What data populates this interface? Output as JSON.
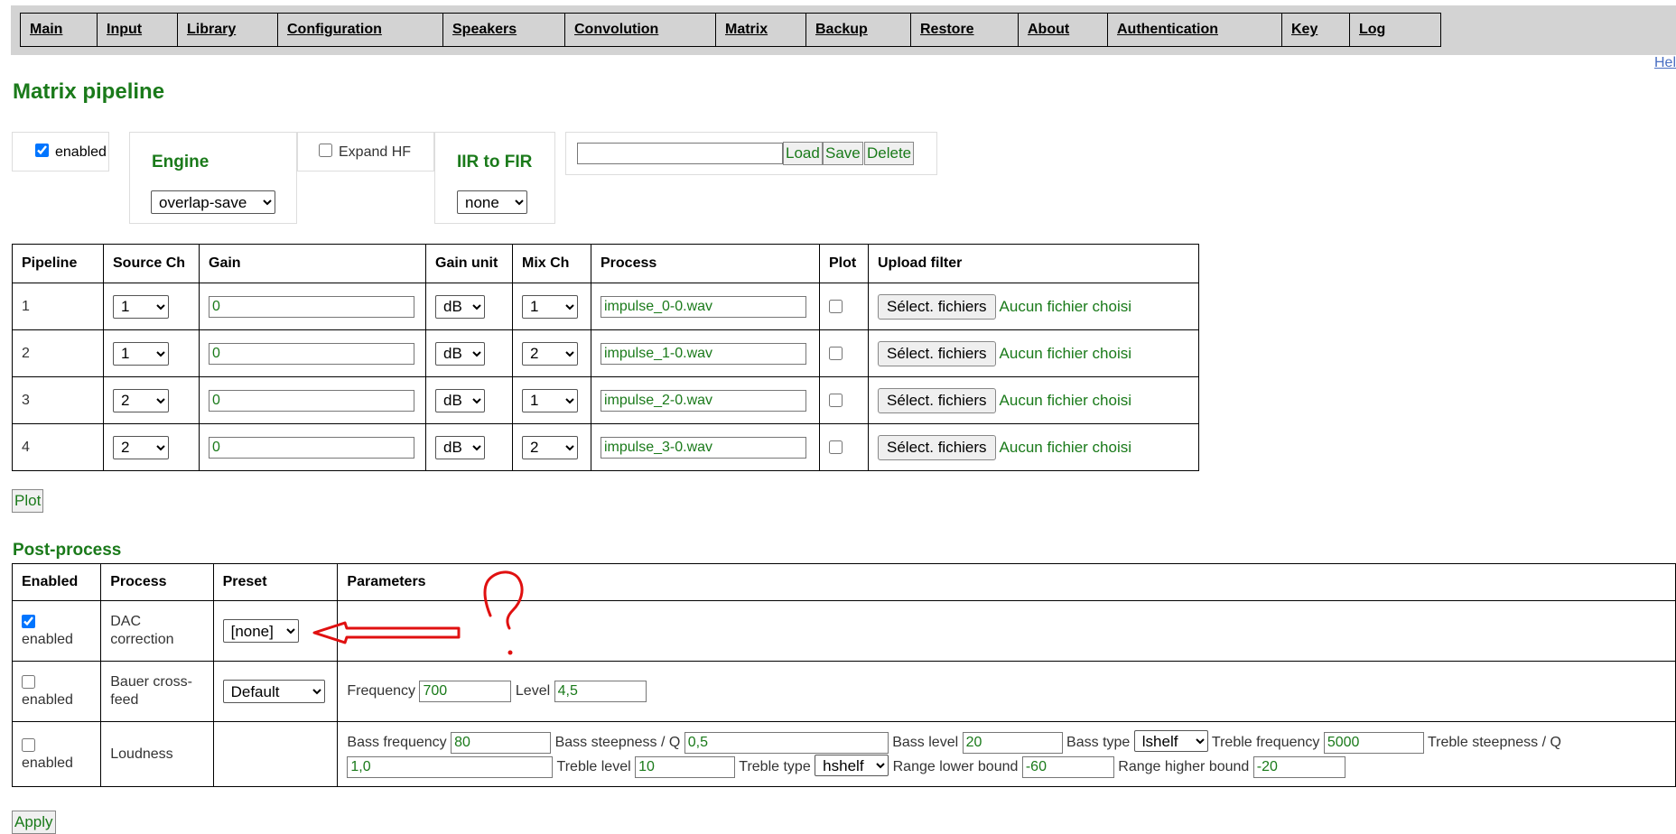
{
  "nav": {
    "items": [
      "Main",
      "Input",
      "Library",
      "Configuration",
      "Speakers",
      "Convolution",
      "Matrix",
      "Backup",
      "Restore",
      "About",
      "Authentication",
      "Key",
      "Log"
    ]
  },
  "help_link": "Hel",
  "page_title": "Matrix pipeline",
  "controls": {
    "enabled_label": "enabled",
    "engine_label": "Engine",
    "engine_value": "overlap-save",
    "expand_hf_label": "Expand HF",
    "iir_to_fir_label": "IIR to FIR",
    "iir_to_fir_value": "none",
    "preset_name_value": "",
    "load_label": "Load",
    "save_label": "Save",
    "delete_label": "Delete"
  },
  "pipeline_table": {
    "headers": [
      "Pipeline",
      "Source Ch",
      "Gain",
      "Gain unit",
      "Mix Ch",
      "Process",
      "Plot",
      "Upload filter"
    ],
    "rows": [
      {
        "pipeline": "1",
        "source_ch": "1",
        "gain": "0",
        "gain_unit": "dB",
        "mix_ch": "1",
        "process": "impulse_0-0.wav",
        "plot": false,
        "file_button": "Sélect. fichiers",
        "file_status": "Aucun fichier choisi"
      },
      {
        "pipeline": "2",
        "source_ch": "1",
        "gain": "0",
        "gain_unit": "dB",
        "mix_ch": "2",
        "process": "impulse_1-0.wav",
        "plot": false,
        "file_button": "Sélect. fichiers",
        "file_status": "Aucun fichier choisi"
      },
      {
        "pipeline": "3",
        "source_ch": "2",
        "gain": "0",
        "gain_unit": "dB",
        "mix_ch": "1",
        "process": "impulse_2-0.wav",
        "plot": false,
        "file_button": "Sélect. fichiers",
        "file_status": "Aucun fichier choisi"
      },
      {
        "pipeline": "4",
        "source_ch": "2",
        "gain": "0",
        "gain_unit": "dB",
        "mix_ch": "2",
        "process": "impulse_3-0.wav",
        "plot": false,
        "file_button": "Sélect. fichiers",
        "file_status": "Aucun fichier choisi"
      }
    ]
  },
  "plot_button": "Plot",
  "post_title": "Post-process",
  "post_table": {
    "headers": [
      "Enabled",
      "Process",
      "Preset",
      "Parameters"
    ],
    "dac": {
      "enabled": true,
      "enabled_label": "enabled",
      "process_line1": "DAC",
      "process_line2": "correction",
      "preset": "[none]"
    },
    "bauer": {
      "enabled": false,
      "enabled_label": "enabled",
      "process_line1": "Bauer cross-",
      "process_line2": "feed",
      "preset": "Default",
      "frequency_label": "Frequency",
      "frequency": "700",
      "level_label": "Level",
      "level": "4,5"
    },
    "loudness": {
      "enabled": false,
      "enabled_label": "enabled",
      "process": "Loudness",
      "bass_frequency_label": "Bass frequency",
      "bass_frequency": "80",
      "bass_q_label": "Bass steepness / Q",
      "bass_q": "0,5",
      "bass_level_label": "Bass level",
      "bass_level": "20",
      "bass_type_label": "Bass type",
      "bass_type": "lshelf",
      "treble_frequency_label": "Treble frequency",
      "treble_frequency": "5000",
      "treble_q_label": "Treble steepness / Q",
      "treble_q": "1,0",
      "treble_level_label": "Treble level",
      "treble_level": "10",
      "treble_type_label": "Treble type",
      "treble_type": "hshelf",
      "range_low_label": "Range lower bound",
      "range_low": "-60",
      "range_high_label": "Range higher bound",
      "range_high": "-20"
    }
  },
  "apply_button": "Apply",
  "annotation": {
    "color": "#e01010"
  }
}
